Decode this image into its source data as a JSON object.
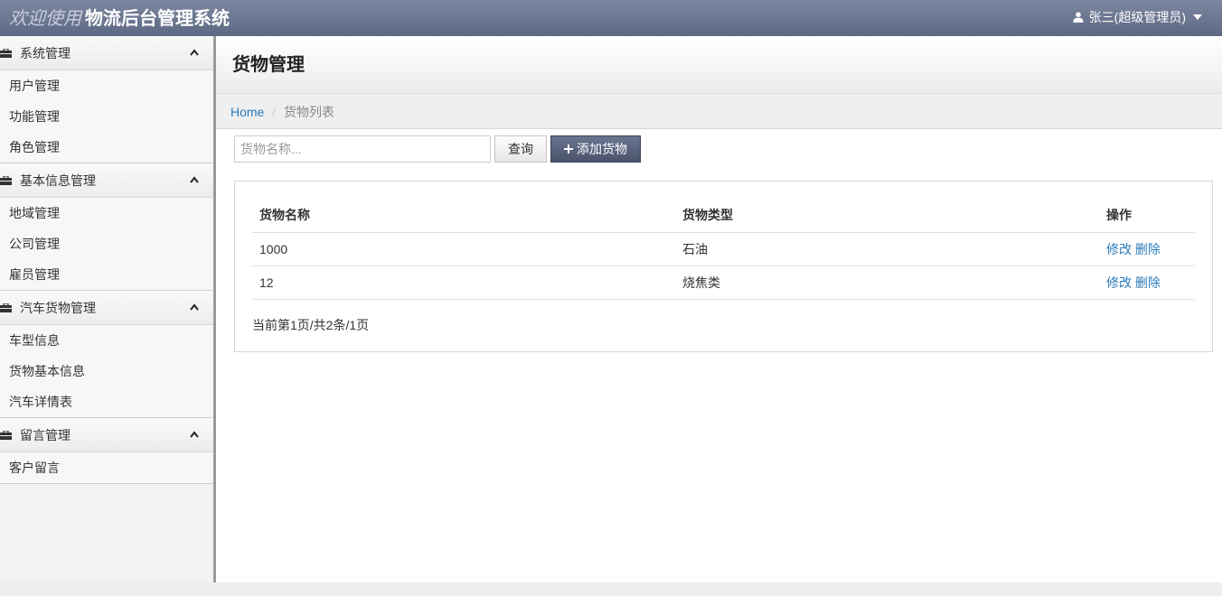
{
  "header": {
    "welcome": "欢迎使用",
    "system_name": "物流后台管理系统",
    "user_label": "张三(超级管理员)"
  },
  "sidebar": {
    "groups": [
      {
        "label": "系统管理",
        "items": [
          "用户管理",
          "功能管理",
          "角色管理"
        ]
      },
      {
        "label": "基本信息管理",
        "items": [
          "地域管理",
          "公司管理",
          "雇员管理"
        ]
      },
      {
        "label": "汽车货物管理",
        "items": [
          "车型信息",
          "货物基本信息",
          "汽车详情表"
        ]
      },
      {
        "label": "留言管理",
        "items": [
          "客户留言"
        ]
      }
    ]
  },
  "page": {
    "title": "货物管理",
    "breadcrumb": {
      "home": "Home",
      "separator": "/",
      "current": "货物列表"
    }
  },
  "toolbar": {
    "search_placeholder": "货物名称...",
    "query_label": "查询",
    "add_label": "添加货物"
  },
  "table": {
    "headers": [
      "货物名称",
      "货物类型",
      "操作"
    ],
    "rows": [
      {
        "name": "1000",
        "type": "石油",
        "edit": "修改",
        "delete": "删除"
      },
      {
        "name": "12",
        "type": "烧焦类",
        "edit": "修改",
        "delete": "删除"
      }
    ],
    "pager": "当前第1页/共2条/1页"
  },
  "colors": {
    "topbar": "#5d6884",
    "link": "#2a7ab8",
    "add_button": "#4a536b"
  }
}
